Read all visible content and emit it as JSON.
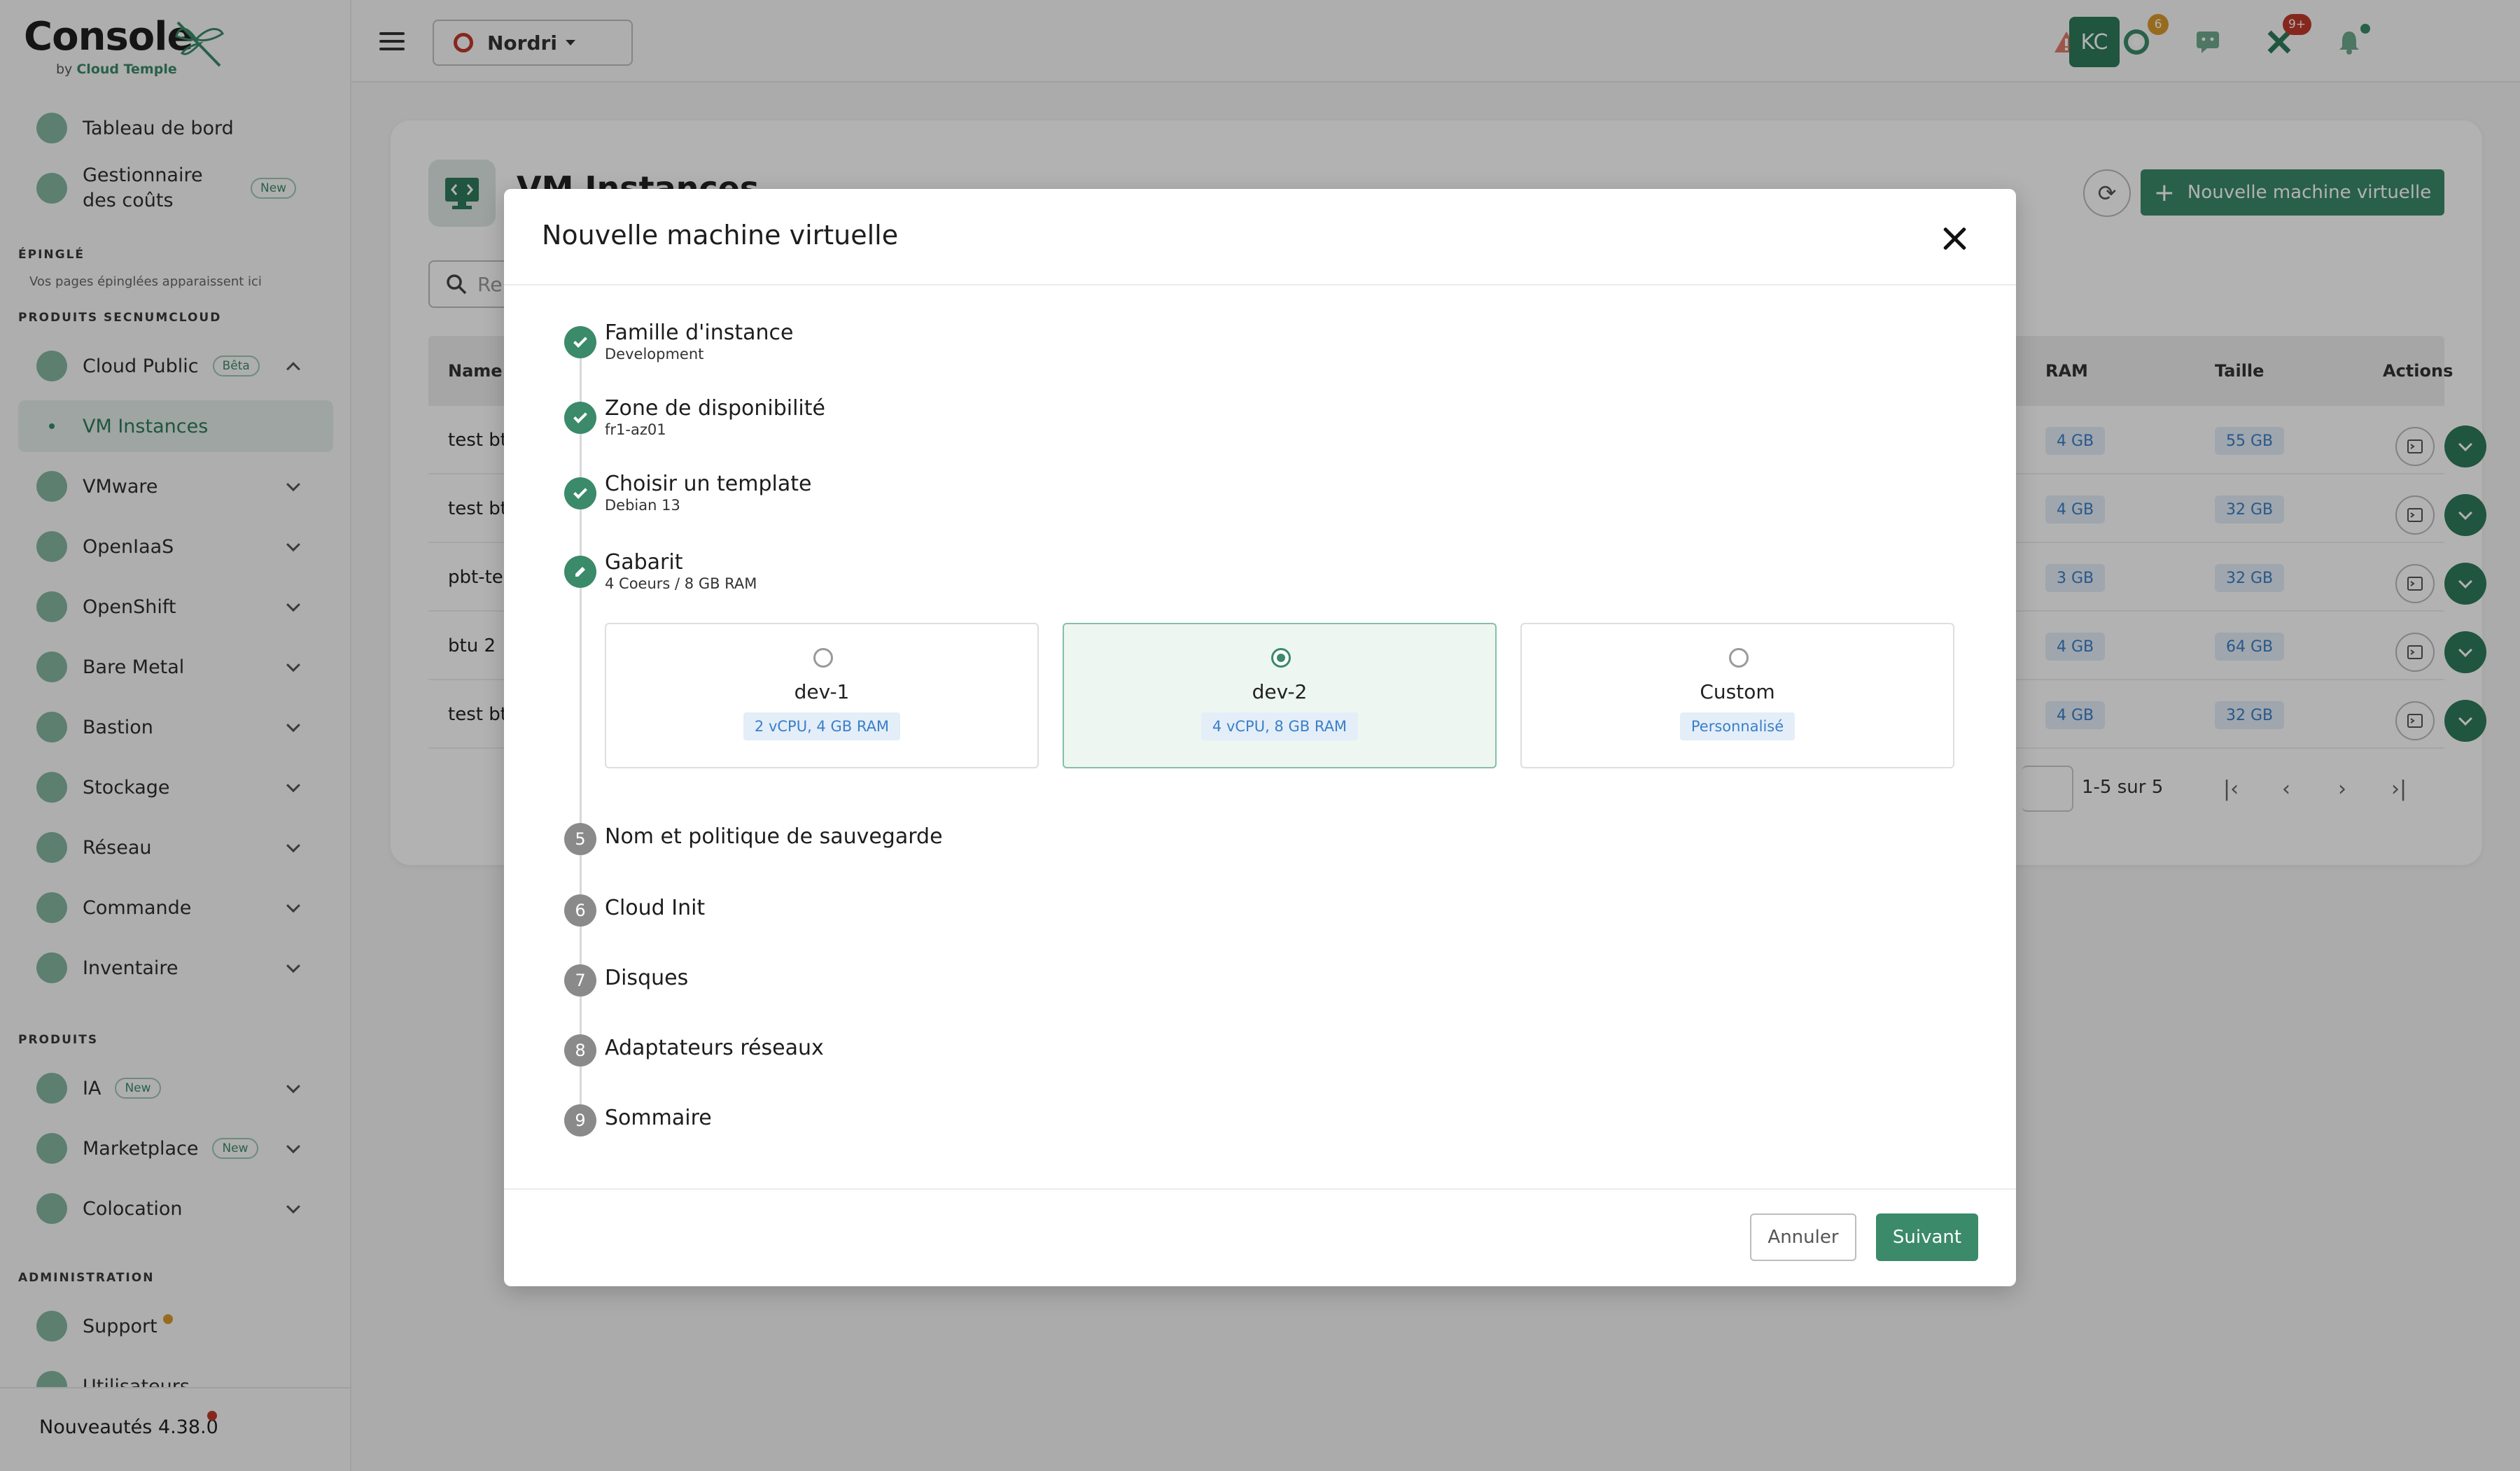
{
  "app": {
    "logo_title": "Console",
    "logo_by": "by",
    "logo_brand": "Cloud Temple"
  },
  "sidebar": {
    "top_items": [
      {
        "label": "Tableau de bord",
        "icon": "dashboard-icon"
      },
      {
        "label": "Gestionnaire des coûts",
        "icon": "euro-icon",
        "badge": "New"
      }
    ],
    "pinned_title": "ÉPINGLÉ",
    "pinned_note": "Vos pages épinglées apparaissent ici",
    "secnum_title": "PRODUITS SECNUMCLOUD",
    "secnum_items": [
      {
        "label": "Cloud Public",
        "icon": "cloud-icon",
        "badge": "Bêta"
      },
      {
        "label": "VM Instances",
        "icon": "dot-icon",
        "active": true
      },
      {
        "label": "VMware",
        "icon": "cloud-icon"
      },
      {
        "label": "OpenIaaS",
        "icon": "cloud-icon"
      },
      {
        "label": "OpenShift",
        "icon": "openshift-icon"
      },
      {
        "label": "Bare Metal",
        "icon": "server-icon"
      },
      {
        "label": "Bastion",
        "icon": "castle-icon"
      },
      {
        "label": "Stockage",
        "icon": "storage-icon"
      },
      {
        "label": "Réseau",
        "icon": "network-icon"
      },
      {
        "label": "Commande",
        "icon": "bag-icon"
      },
      {
        "label": "Inventaire",
        "icon": "clipboard-icon"
      }
    ],
    "products_title": "PRODUITS",
    "product_items": [
      {
        "label": "IA",
        "icon": "brain-icon",
        "badge": "New"
      },
      {
        "label": "Marketplace",
        "icon": "store-icon",
        "badge": "New"
      },
      {
        "label": "Colocation",
        "icon": "home-icon"
      }
    ],
    "admin_title": "ADMINISTRATION",
    "admin_items": [
      {
        "label": "Support",
        "icon": "lifebuoy-icon"
      },
      {
        "label": "Utilisateurs",
        "icon": "users-icon"
      }
    ],
    "footer_label": "Nouveautés 4.38.0"
  },
  "topbar": {
    "tenant": "Nordri",
    "badges": {
      "tickets": "6",
      "incidents": "9+"
    },
    "avatar": "KC"
  },
  "page": {
    "title": "VM Instances",
    "new_vm_label": "Nouvelle machine virtuelle",
    "search_placeholder": "Re",
    "columns": {
      "name": "Name",
      "ram": "RAM",
      "size": "Taille",
      "actions": "Actions"
    },
    "rows": [
      {
        "name": "test bt",
        "ram": "4 GB",
        "size": "55 GB"
      },
      {
        "name": "test bt",
        "ram": "4 GB",
        "size": "32 GB"
      },
      {
        "name": "pbt-te",
        "ram": "3 GB",
        "size": "32 GB"
      },
      {
        "name": "btu 2",
        "ram": "4 GB",
        "size": "64 GB"
      },
      {
        "name": "test bt",
        "ram": "4 GB",
        "size": "32 GB"
      }
    ],
    "pagination": "1-5 sur 5"
  },
  "modal": {
    "title": "Nouvelle machine virtuelle",
    "steps": [
      {
        "num": "1",
        "title": "Famille d'instance",
        "value": "Development",
        "state": "done"
      },
      {
        "num": "2",
        "title": "Zone de disponibilité",
        "value": "fr1-az01",
        "state": "done"
      },
      {
        "num": "3",
        "title": "Choisir un template",
        "value": "Debian 13",
        "state": "done"
      },
      {
        "num": "4",
        "title": "Gabarit",
        "value": "4 Coeurs / 8 GB RAM",
        "state": "active"
      },
      {
        "num": "5",
        "title": "Nom et politique de sauvegarde",
        "state": "todo"
      },
      {
        "num": "6",
        "title": "Cloud Init",
        "state": "todo"
      },
      {
        "num": "7",
        "title": "Disques",
        "state": "todo"
      },
      {
        "num": "8",
        "title": "Adaptateurs réseaux",
        "state": "todo"
      },
      {
        "num": "9",
        "title": "Sommaire",
        "state": "todo"
      }
    ],
    "options": [
      {
        "name": "dev-1",
        "spec": "2 vCPU, 4 GB RAM",
        "selected": false
      },
      {
        "name": "dev-2",
        "spec": "4 vCPU, 8 GB RAM",
        "selected": true
      },
      {
        "name": "Custom",
        "spec": "Personnalisé",
        "selected": false
      }
    ],
    "cancel_label": "Annuler",
    "next_label": "Suivant"
  },
  "colors": {
    "accent": "#3b8a6a",
    "tag_blue": "#3a7fc8",
    "alert_red": "#c0392b",
    "warning_orange": "#d99a2b"
  }
}
